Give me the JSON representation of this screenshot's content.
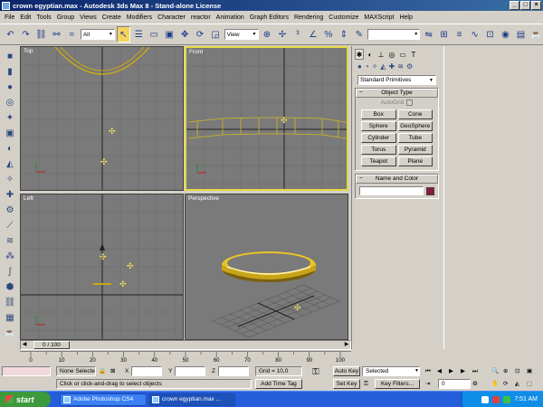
{
  "window": {
    "title": "crown egyptian.max - Autodesk 3ds Max 8 - Stand-alone License",
    "min_label": "_",
    "max_label": "□",
    "close_label": "×"
  },
  "menu": [
    "File",
    "Edit",
    "Tools",
    "Group",
    "Views",
    "Create",
    "Modifiers",
    "Character",
    "reactor",
    "Animation",
    "Graph Editors",
    "Rendering",
    "Customize",
    "MAXScript",
    "Help"
  ],
  "toolbar": {
    "selection_filter": "All",
    "reference_coord": "View",
    "named_selection": ""
  },
  "viewports": {
    "top": "Top",
    "front": "Front",
    "left": "Left",
    "perspective": "Perspective"
  },
  "command_panel": {
    "category": "Standard Primitives",
    "object_type_title": "Object Type",
    "autogrid": "AutoGrid",
    "buttons": [
      "Box",
      "Cone",
      "Sphere",
      "GeoSphere",
      "Cylinder",
      "Tube",
      "Torus",
      "Pyramid",
      "Teapot",
      "Plane"
    ],
    "name_color_title": "Name and Color",
    "object_color": "#8a1a3a"
  },
  "timeline": {
    "frame_label": "0 / 100",
    "current_frame": 0,
    "total_frames": 100,
    "ticks": [
      "0",
      "10",
      "20",
      "30",
      "40",
      "50",
      "60",
      "70",
      "80",
      "90",
      "100"
    ]
  },
  "status": {
    "selection": "None Selecte",
    "x_label": "X",
    "y_label": "Y",
    "z_label": "Z",
    "grid": "Grid = 10,0",
    "prompt": "Click or click-and-drag to select objects",
    "add_time_tag": "Add Time Tag",
    "auto_key": "Auto Key",
    "set_key": "Set Key",
    "key_mode": "Selected",
    "key_filters": "Key Filters...",
    "frame_value": "0"
  },
  "taskbar": {
    "start": "start",
    "tasks": [
      "Adobe Photoshop CS4",
      "crown egyptian.max ..."
    ],
    "time": "7:51 AM"
  },
  "colors": {
    "viewport_bg": "#7a7a7a",
    "active_border": "#e6d844",
    "object_gold": "#d4b020",
    "taskbar": "#245edb"
  }
}
